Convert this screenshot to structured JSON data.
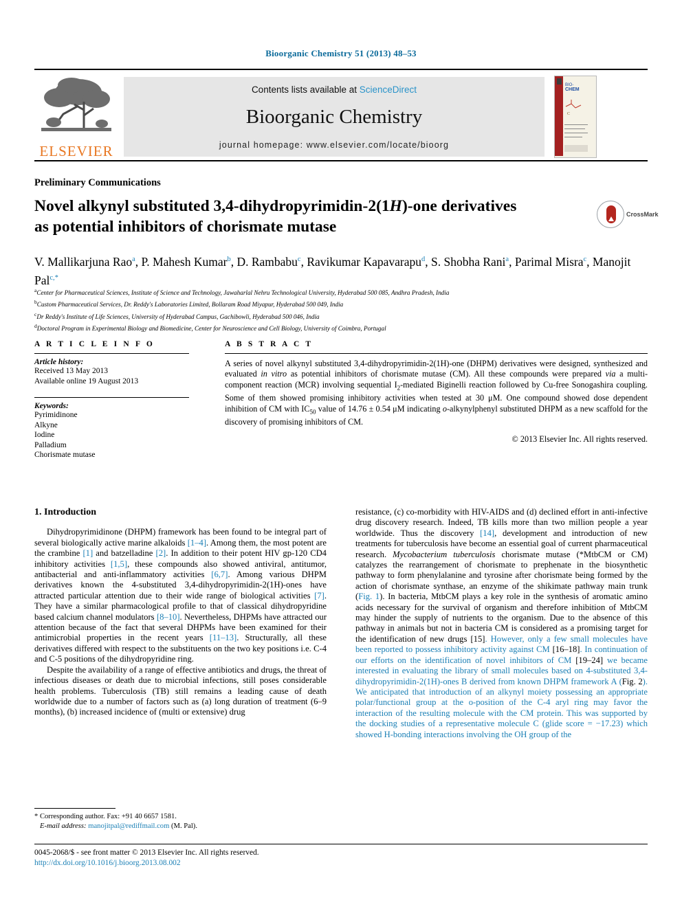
{
  "running_head": "Bioorganic Chemistry 51 (2013) 48–53",
  "masthead": {
    "contents_prefix": "Contents lists available at ",
    "sciencedirect": "ScienceDirect",
    "journal_name": "Bioorganic Chemistry",
    "homepage": "journal homepage: www.elsevier.com/locate/bioorg",
    "publisher_logo_text": "ELSEVIER",
    "cover_line1": "BIO-ORGANIC",
    "cover_line2": "CHEMISTRY"
  },
  "article": {
    "section_label": "Preliminary Communications",
    "title_line1_a": "Novel alkynyl substituted 3,4-dihydropyrimidin-2(1",
    "title_line1_italic": "H",
    "title_line1_b": ")-one derivatives",
    "title_line2": "as potential inhibitors of chorismate mutase",
    "crossmark_label": "CrossMark"
  },
  "authors": [
    {
      "name": "V. Mallikarjuna Rao",
      "sup": "a",
      "sep": ", "
    },
    {
      "name": "P. Mahesh Kumar",
      "sup": "b",
      "sep": ", "
    },
    {
      "name": "D. Rambabu",
      "sup": "c",
      "sep": ", "
    },
    {
      "name": "Ravikumar Kapavarapu",
      "sup": "d",
      "sep": ", "
    },
    {
      "name": "S. Shobha Rani",
      "sup": "a",
      "sep": ", "
    },
    {
      "name": "Parimal Misra",
      "sup": "c",
      "sep": ", "
    },
    {
      "name": "Manojit Pal",
      "sup": "c,*",
      "sep": ""
    }
  ],
  "affiliations": [
    {
      "marker": "a",
      "text": "Center for Pharmaceutical Sciences, Institute of Science and Technology, Jawaharlal Nehru Technological University, Hyderabad 500 085, Andhra Pradesh, India"
    },
    {
      "marker": "b",
      "text": "Custom Pharmaceutical Services, Dr. Reddy's Laboratories Limited, Bollaram Road Miyapur, Hyderabad 500 049, India"
    },
    {
      "marker": "c",
      "text": "Dr Reddy's Institute of Life Sciences, University of Hyderabad Campus, Gachibowli, Hyderabad 500 046, India"
    },
    {
      "marker": "d",
      "text": "Doctoral Program in Experimental Biology and Biomedicine, Center for Neuroscience and Cell Biology, University of Coimbra, Portugal"
    }
  ],
  "article_info": {
    "heading": "A R T I C L E    I N F O",
    "history_label": "Article history:",
    "received": "Received 13 May 2013",
    "available_online": "Available online 19 August 2013",
    "keywords_label": "Keywords:",
    "keywords": [
      "Pyrimidinone",
      "Alkyne",
      "Iodine",
      "Palladium",
      "Chorismate mutase"
    ]
  },
  "abstract": {
    "heading": "A B S T R A C T",
    "part1": "A series of novel alkynyl substituted 3,4-dihydropyrimidin-2(1H)-one (DHPM) derivatives were designed, synthesized and evaluated ",
    "italic1": "in vitro",
    "part2": " as potential inhibitors of chorismate mutase (CM). All these compounds were prepared ",
    "italic2": "via",
    "part3": " a multi-component reaction (MCR) involving sequential I",
    "sub1": "2",
    "part4": "-mediated Biginelli reaction followed by Cu-free Sonogashira coupling. Some of them showed promising inhibitory activities when tested at 30 μM. One compound showed dose dependent inhibition of CM with IC",
    "sub2": "50",
    "part5": " value of 14.76 ± 0.54 μM indicating ",
    "italic3": "o",
    "part6": "-alkynylphenyl substituted DHPM as a new scaffold for the discovery of promising inhibitors of CM.",
    "copyright": "© 2013 Elsevier Inc. All rights reserved."
  },
  "body": {
    "section_number_title": "1. Introduction",
    "left_paragraph_1": [
      "Dihydropyrimidinone (DHPM) framework has been found to be integral part of several biologically active marine alkaloids ",
      "[1–4]",
      ". Among them, the most potent are the crambine ",
      "[1]",
      " and batzelladine ",
      "[2]",
      ". In addition to their potent HIV gp-120 CD4 inhibitory activities ",
      "[1,5]",
      ", these compounds also showed antiviral, antitumor, antibacterial and anti-inflammatory activities ",
      "[6,7]",
      ". Among various DHPM derivatives known the 4-substituted 3,4-dihydropyrimidin-2(1H)-ones have attracted particular attention due to their wide range of biological activities ",
      "[7]",
      ". They have a similar pharmacological profile to that of classical dihydropyridine based calcium channel modulators ",
      "[8–10]",
      ". Nevertheless, DHPMs have attracted our attention because of the fact that several DHPMs have been examined for their antimicrobial properties in the recent years ",
      "[11–13]",
      ". Structurally, all these derivatives differed with respect to the substituents on the two key positions i.e. C-4 and C-5 positions of the dihydropyridine ring."
    ],
    "left_paragraph_2": "Despite the availability of a range of effective antibiotics and drugs, the threat of infectious diseases or death due to microbial infections, still poses considerable health problems. Tuberculosis (TB) still remains a leading cause of death worldwide due to a number of factors such as (a) long duration of treatment (6–9 months), (b) increased incidence of (multi or extensive) drug",
    "right_paragraph_1": [
      "resistance, (c) co-morbidity with HIV-AIDS and (d) declined effort in anti-infective drug discovery research. Indeed, TB kills more than two million people a year worldwide. Thus the discovery ",
      "[14]",
      ", development and introduction of new treatments for tuberculosis have become an essential goal of current pharmaceutical research. ",
      "Mycobacterium tuberculosis",
      " chorismate mutase (*MtbCM or CM) catalyzes the rearrangement of chorismate to prephenate in the biosynthetic pathway to form phenylalanine and tyrosine after chorismate being formed by the action of chorismate synthase, an enzyme of the shikimate pathway main trunk (",
      "Fig. 1",
      "). In bacteria, MtbCM plays a key role in the synthesis of aromatic amino acids necessary for the survival of organism and therefore inhibition of MtbCM may hinder the supply of nutrients to the organism. Due to the absence of this pathway in animals but not in bacteria CM is considered as a promising target for the identification of new drugs ",
      "[15]",
      ". However, only a few small molecules have been reported to possess inhibitory activity against CM ",
      "[16–18]",
      ". In continuation of our efforts on the identification of novel inhibitors of CM ",
      "[19–24]",
      " we became interested in evaluating the library of small molecules based on 4-substituted 3,4-dihydropyrimidin-2(1H)-ones B derived from known DHPM framework A (",
      "Fig. 2",
      "). We anticipated that introduction of an alkynyl moiety possessing an appropriate polar/functional group at the o-position of the C-4 aryl ring may favor the interaction of the resulting molecule with the CM protein. This was supported by the docking studies of a representative molecule C (glide score = −17.23) which showed H-bonding interactions involving the OH group of the"
    ]
  },
  "footnote": {
    "corresponding": "* Corresponding author. Fax: +91 40 6657 1581.",
    "email_label": "E-mail address:",
    "email": "manojitpal@rediffmail.com",
    "email_suffix": " (M. Pal)."
  },
  "footer": {
    "issn_line": "0045-2068/$ - see front matter © 2013 Elsevier Inc. All rights reserved.",
    "doi": "http://dx.doi.org/10.1016/j.bioorg.2013.08.002"
  },
  "colors": {
    "link_blue": "#1a7fb5",
    "header_blue": "#0b6a9a",
    "sciencedirect_blue": "#2a93c9",
    "elsevier_orange": "#E87722",
    "crossmark_red": "#b3261e"
  }
}
